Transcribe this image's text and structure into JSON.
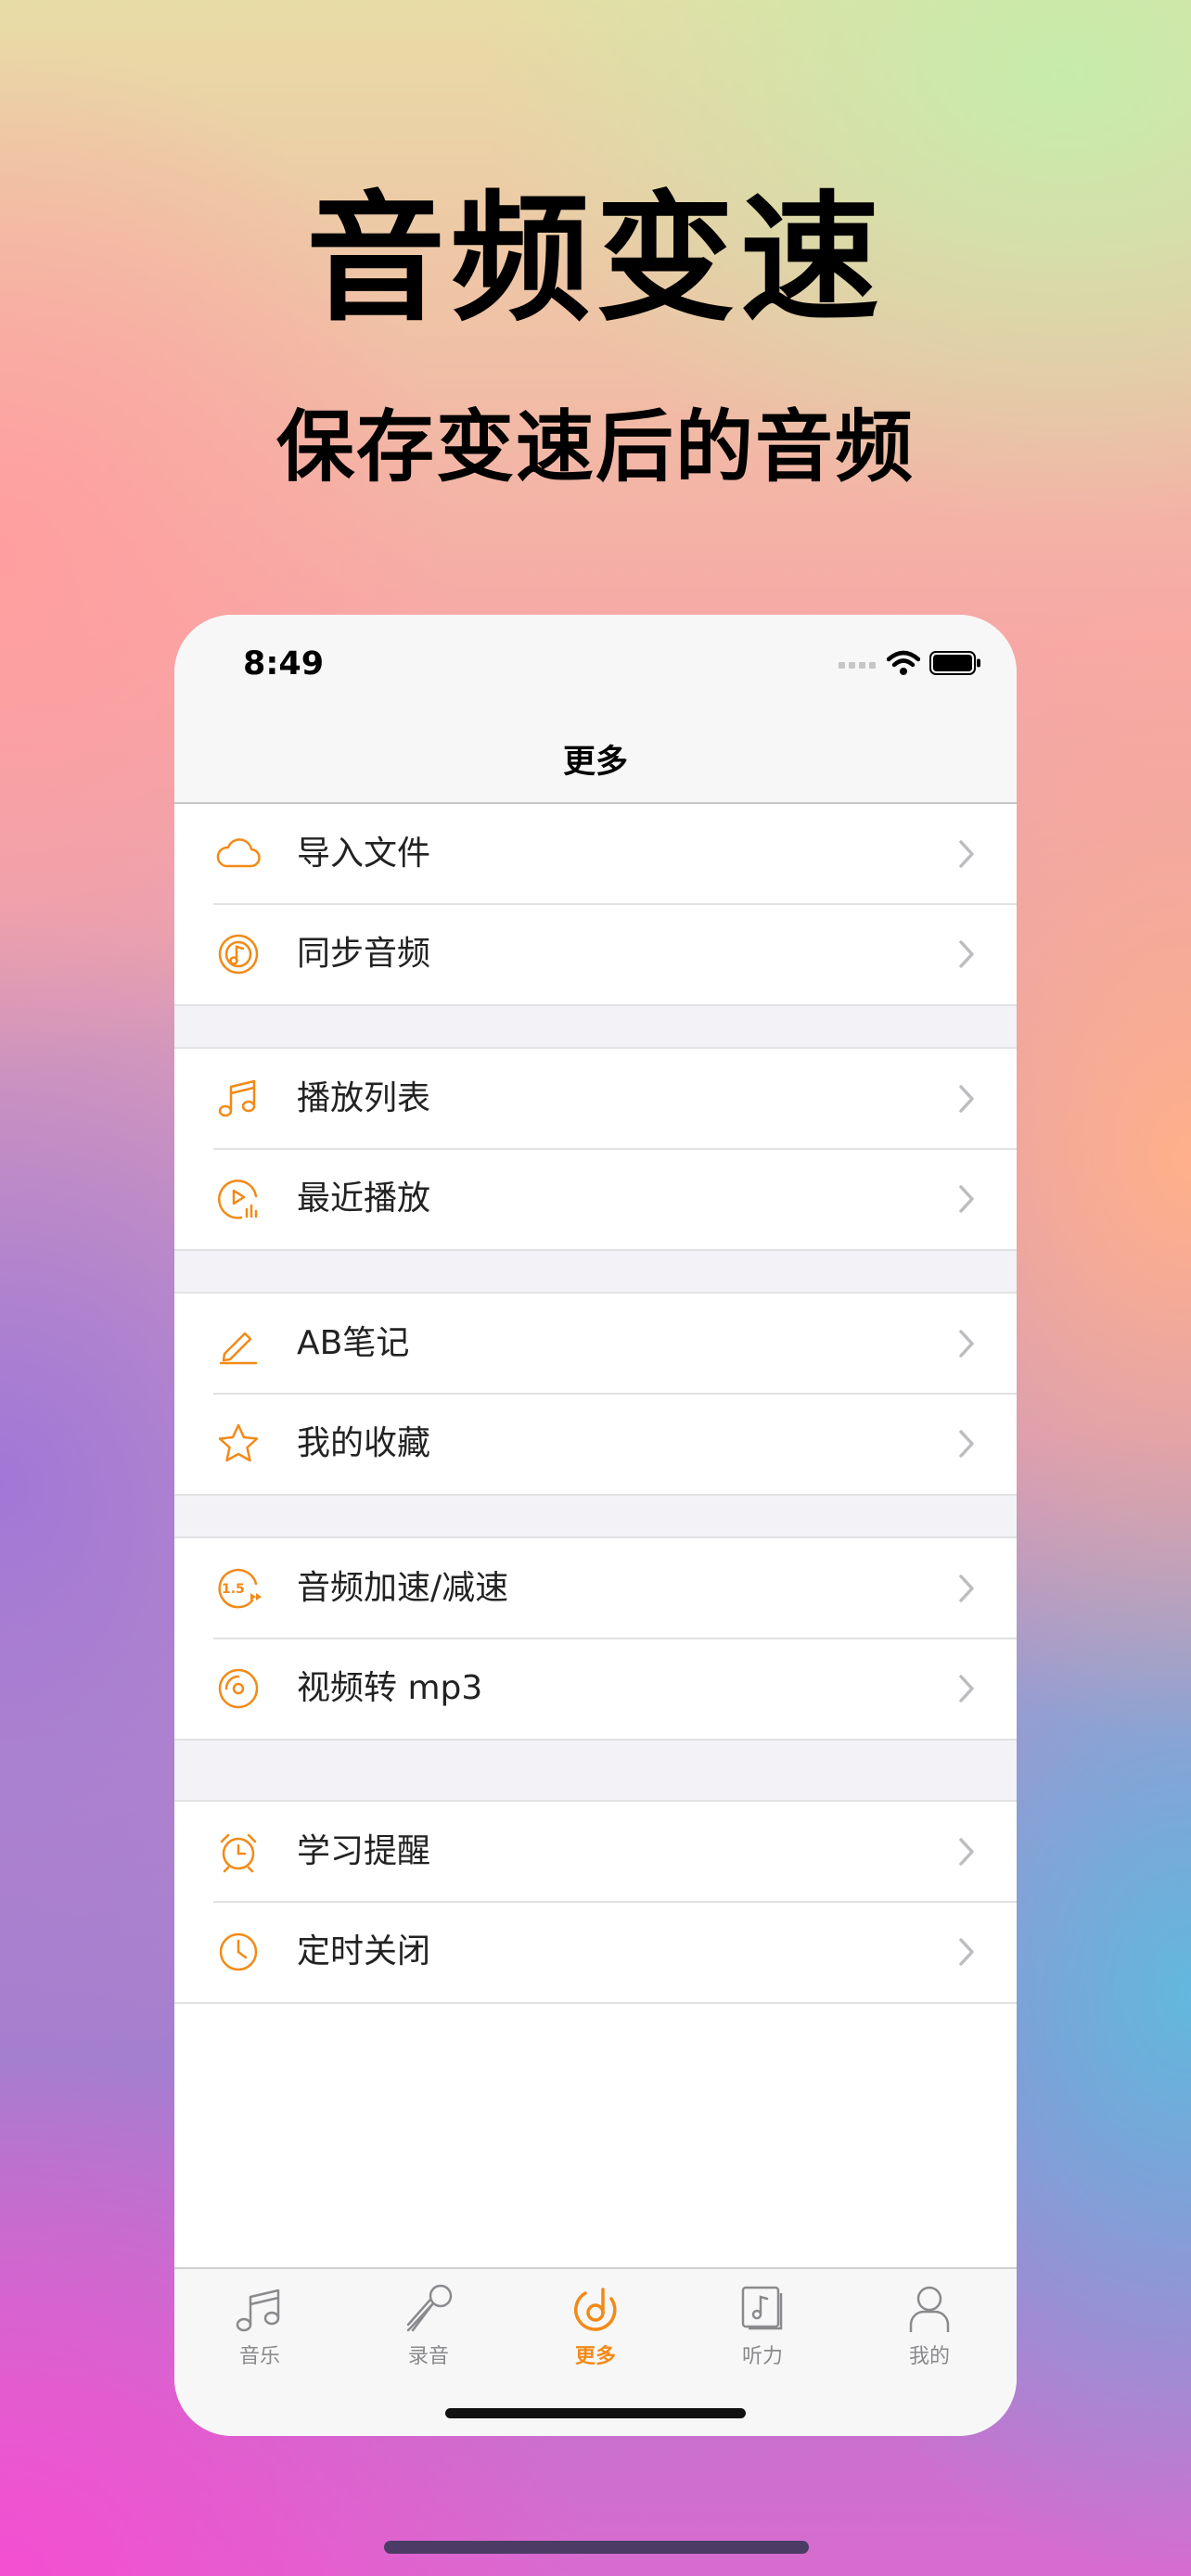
{
  "headline": "音频变速",
  "subline": "保存变速后的音频",
  "status_bar": {
    "time": "8:49"
  },
  "nav": {
    "title": "更多"
  },
  "accent_color": "#F28A17",
  "menu_groups": [
    [
      {
        "label": "导入文件",
        "icon": "cloud-icon"
      },
      {
        "label": "同步音频",
        "icon": "sync-music-icon"
      }
    ],
    [
      {
        "label": "播放列表",
        "icon": "music-note-icon"
      },
      {
        "label": "最近播放",
        "icon": "recent-play-icon"
      }
    ],
    [
      {
        "label": "AB笔记",
        "icon": "pencil-icon"
      },
      {
        "label": "我的收藏",
        "icon": "star-icon"
      }
    ],
    [
      {
        "label": "音频加速/减速",
        "icon": "speed-icon"
      },
      {
        "label": "视频转 mp3",
        "icon": "disc-icon"
      }
    ],
    [
      {
        "label": "学习提醒",
        "icon": "alarm-clock-icon"
      },
      {
        "label": "定时关闭",
        "icon": "clock-icon"
      }
    ]
  ],
  "tabs": [
    {
      "label": "音乐",
      "icon": "music-icon",
      "active": false
    },
    {
      "label": "录音",
      "icon": "microphone-icon",
      "active": false
    },
    {
      "label": "更多",
      "icon": "more-icon",
      "active": true
    },
    {
      "label": "听力",
      "icon": "listening-icon",
      "active": false
    },
    {
      "label": "我的",
      "icon": "person-icon",
      "active": false
    }
  ]
}
